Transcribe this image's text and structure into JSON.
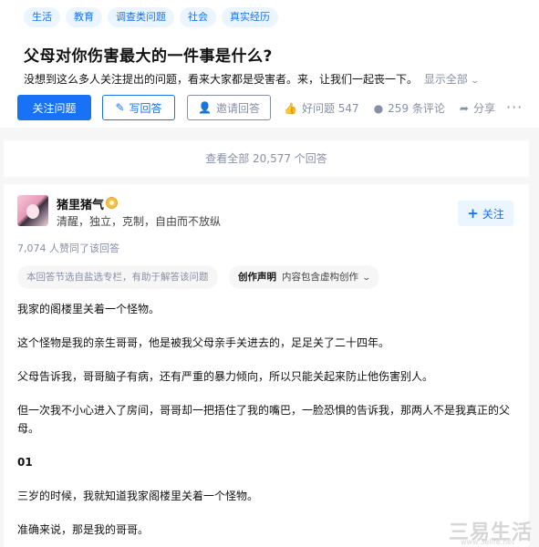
{
  "tags": [
    "生活",
    "教育",
    "调查类问题",
    "社会",
    "真实经历"
  ],
  "question": {
    "title": "父母对你伤害最大的一件事是什么?",
    "description": "没想到这么多人关注提出的问题，看来大家都是受害者。来，让我们一起丧一下。",
    "show_all": "显示全部"
  },
  "buttons": {
    "follow": "关注问题",
    "write": "写回答",
    "invite": "邀请回答"
  },
  "actions": {
    "good_question": "好问题 547",
    "comments": "259 条评论",
    "share": "分享"
  },
  "view_all": "查看全部 20,577 个回答",
  "answer": {
    "author": "猪里猪气",
    "bio": "清醒，独立，克制，自由而不放纵",
    "follow": "关注",
    "likes": "7,074 人赞同了该回答",
    "notice_column": "本回答节选自盐选专栏，有助于解答该问题",
    "notice_label": "创作声明",
    "notice_text": "内容包含虚构创作",
    "paragraphs": [
      "我家的阁楼里关着一个怪物。",
      "这个怪物是我的亲生哥哥，他是被我父母亲手关进去的，足足关了二十四年。",
      "父母告诉我，哥哥脑子有病，还有严重的暴力倾向，所以只能关起来防止他伤害别人。",
      "但一次我不小心进入了房间，哥哥却一把捂住了我的嘴巴，一脸恐惧的告诉我，那两人不是我真正的父母。",
      "01",
      "三岁的时候，我就知道我家阁楼里关着一个怪物。",
      "准确来说，那是我的哥哥。"
    ]
  },
  "watermark": {
    "main": "三易生活",
    "sub": "www.3elife.net"
  },
  "colors": {
    "accent": "#1772f6",
    "muted": "#8590a6",
    "tag_bg": "#ebf5ff"
  }
}
